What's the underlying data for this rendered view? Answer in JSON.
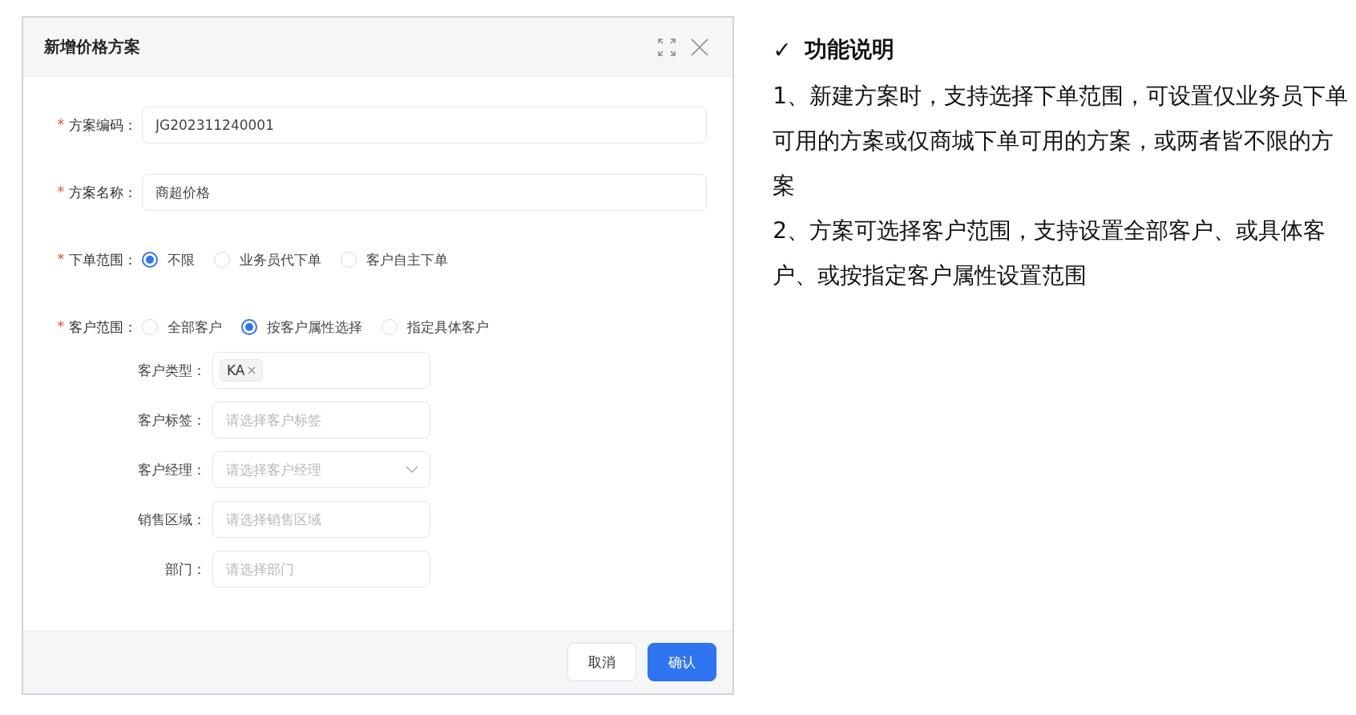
{
  "dialog": {
    "title": "新增价格方案",
    "fields": [
      {
        "kind": "input",
        "label": "方案编码：",
        "required_mark": "*",
        "value": "JG202311240001"
      },
      {
        "kind": "input",
        "label": "方案名称：",
        "required_mark": "*",
        "value": "商超价格"
      },
      {
        "kind": "radio",
        "label": "下单范围：",
        "required_mark": "*",
        "options": [
          {
            "label": "不限",
            "selected": true
          },
          {
            "label": "业务员代下单",
            "selected": false
          },
          {
            "label": "客户自主下单",
            "selected": false
          }
        ]
      },
      {
        "kind": "radio",
        "label": "客户范围：",
        "required_mark": "*",
        "options": [
          {
            "label": "全部客户",
            "selected": false
          },
          {
            "label": "按客户属性选择",
            "selected": true
          },
          {
            "label": "指定具体客户",
            "selected": false
          }
        ]
      }
    ],
    "sub_fields": [
      {
        "kind": "tags",
        "label": "客户类型：",
        "tags": [
          "KA"
        ]
      },
      {
        "kind": "input",
        "label": "客户标签：",
        "placeholder": "请选择客户标签"
      },
      {
        "kind": "select",
        "label": "客户经理：",
        "placeholder": "请选择客户经理"
      },
      {
        "kind": "input",
        "label": "销售区域：",
        "placeholder": "请选择销售区域"
      },
      {
        "kind": "input",
        "label": "部门：",
        "placeholder": "请选择部门"
      }
    ],
    "buttons": [
      {
        "label": "取消",
        "kind": "default"
      },
      {
        "label": "确认",
        "kind": "primary"
      }
    ]
  },
  "notes": {
    "check": "✓",
    "title": "功能说明",
    "paragraphs": [
      "1、新建方案时，支持选择下单范围，可设置仅业务员下单可用的方案或仅商城下单可用的方案，或两者皆不限的方案",
      "2、方案可选择客户范围，支持设置全部客户、或具体客户、或按指定客户属性设置范围"
    ]
  }
}
